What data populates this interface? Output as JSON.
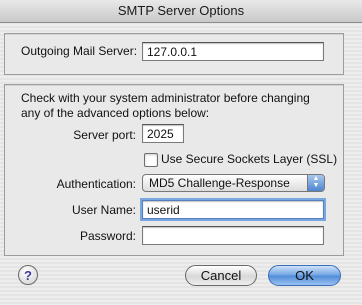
{
  "window": {
    "title": "SMTP Server Options"
  },
  "outgoing": {
    "label": "Outgoing Mail Server:",
    "value": "127.0.0.1"
  },
  "advanced": {
    "note": "Check with your system administrator before changing any of the advanced options below:",
    "port_label": "Server port:",
    "port_value": "2025",
    "ssl_label": "Use Secure Sockets Layer (SSL)",
    "ssl_checked": false,
    "auth_label": "Authentication:",
    "auth_value": "MD5 Challenge-Response",
    "username_label": "User Name:",
    "username_value": "userid",
    "password_label": "Password:",
    "password_value": ""
  },
  "buttons": {
    "help": "?",
    "cancel": "Cancel",
    "ok": "OK"
  },
  "icons": {
    "popup_arrows": "updown-arrows-icon",
    "help": "help-icon"
  }
}
